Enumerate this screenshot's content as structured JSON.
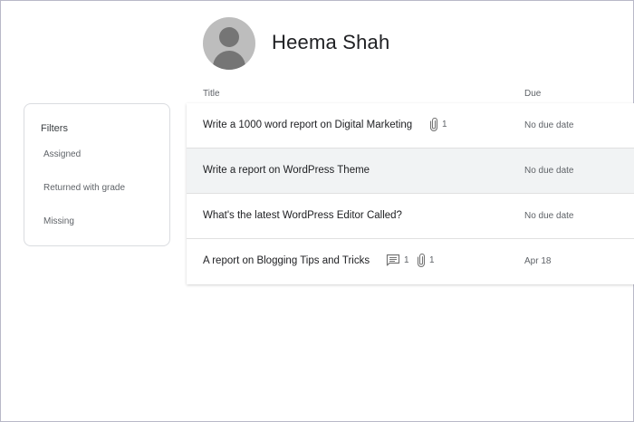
{
  "student": {
    "name": "Heema Shah"
  },
  "filters": {
    "title": "Filters",
    "items": [
      "Assigned",
      "Returned with grade",
      "Missing"
    ]
  },
  "columns": {
    "title": "Title",
    "due": "Due"
  },
  "assignments": [
    {
      "title": "Write a 1000 word report on Digital Marketing",
      "comments": null,
      "attachments": "1",
      "due": "No due date"
    },
    {
      "title": "Write a report on WordPress Theme",
      "comments": null,
      "attachments": null,
      "due": "No due date"
    },
    {
      "title": "What's the latest WordPress Editor Called?",
      "comments": null,
      "attachments": null,
      "due": "No due date"
    },
    {
      "title": "A report on Blogging Tips and Tricks",
      "comments": "1",
      "attachments": "1",
      "due": "Apr 18"
    }
  ],
  "icons": {
    "avatar": "person-icon",
    "comment": "comment-icon",
    "attachment": "paperclip-icon"
  }
}
